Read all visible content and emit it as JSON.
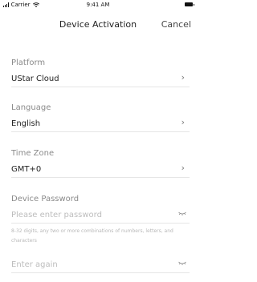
{
  "status_bar": {
    "carrier": "Carrier",
    "time": "9:41 AM"
  },
  "nav": {
    "title": "Device Activation",
    "cancel": "Cancel"
  },
  "fields": {
    "platform": {
      "label": "Platform",
      "value": "UStar Cloud"
    },
    "language": {
      "label": "Language",
      "value": "English"
    },
    "time_zone": {
      "label": "Time Zone",
      "value": "GMT+0"
    },
    "device_password": {
      "label": "Device Password",
      "placeholder": "Please enter password",
      "hint": "8-32 digits, any two or more combinations of numbers, letters, and characters"
    },
    "confirm_password": {
      "placeholder": "Enter again"
    }
  },
  "icons": {
    "chevron": "chevron-right-icon",
    "eye": "eye-closed-icon",
    "signal": "signal-icon",
    "wifi": "wifi-icon",
    "battery": "battery-icon"
  }
}
